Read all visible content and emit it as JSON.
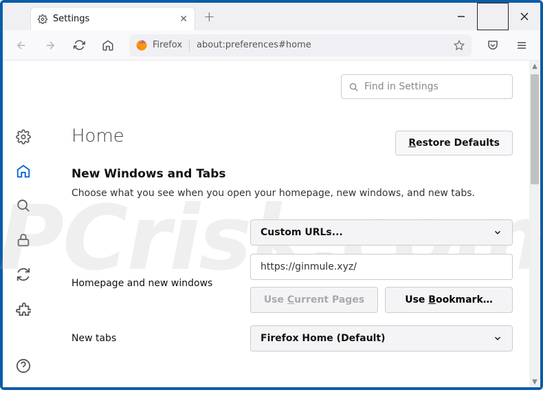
{
  "tab": {
    "title": "Settings"
  },
  "urlbar": {
    "identity": "Firefox",
    "url": "about:preferences#home"
  },
  "search": {
    "placeholder": "Find in Settings"
  },
  "page": {
    "title": "Home",
    "restore": "Restore Defaults",
    "section_title": "New Windows and Tabs",
    "section_desc": "Choose what you see when you open your homepage, new windows, and new tabs."
  },
  "homepage": {
    "select": "Custom URLs...",
    "label": "Homepage and new windows",
    "value": "https://ginmule.xyz/",
    "use_current": "Use Current Pages",
    "use_bookmark": "Use Bookmark…"
  },
  "newtabs": {
    "label": "New tabs",
    "select": "Firefox Home (Default)"
  },
  "watermark": "PCrisk.com"
}
